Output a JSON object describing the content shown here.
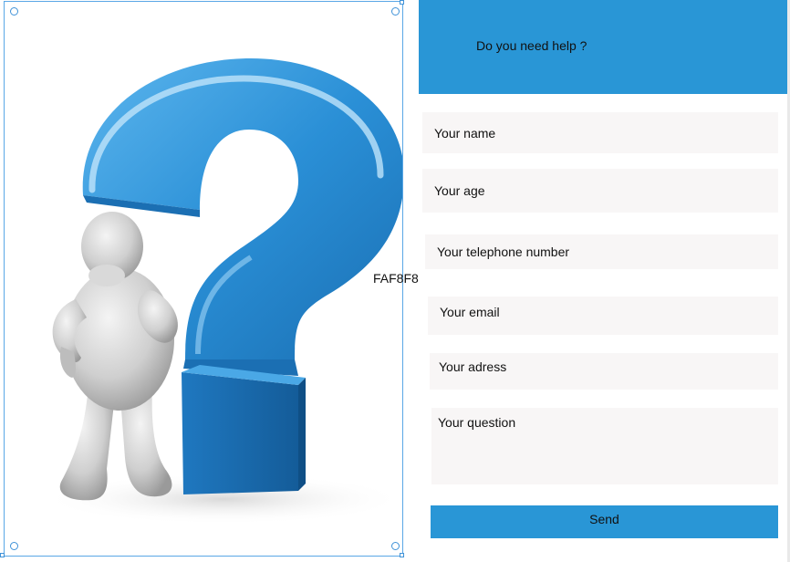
{
  "canvas": {
    "label": "FAF8F8"
  },
  "header": {
    "title": "Do you need help ?"
  },
  "form": {
    "name_placeholder": "Your name",
    "age_placeholder": "Your age",
    "phone_placeholder": "Your telephone number",
    "email_placeholder": "Your email",
    "address_placeholder": "Your adress",
    "question_placeholder": "Your question",
    "send_label": "Send"
  },
  "colors": {
    "accent": "#2996d6",
    "field_bg": "#f8f6f6",
    "selection": "#5aa7e6"
  }
}
